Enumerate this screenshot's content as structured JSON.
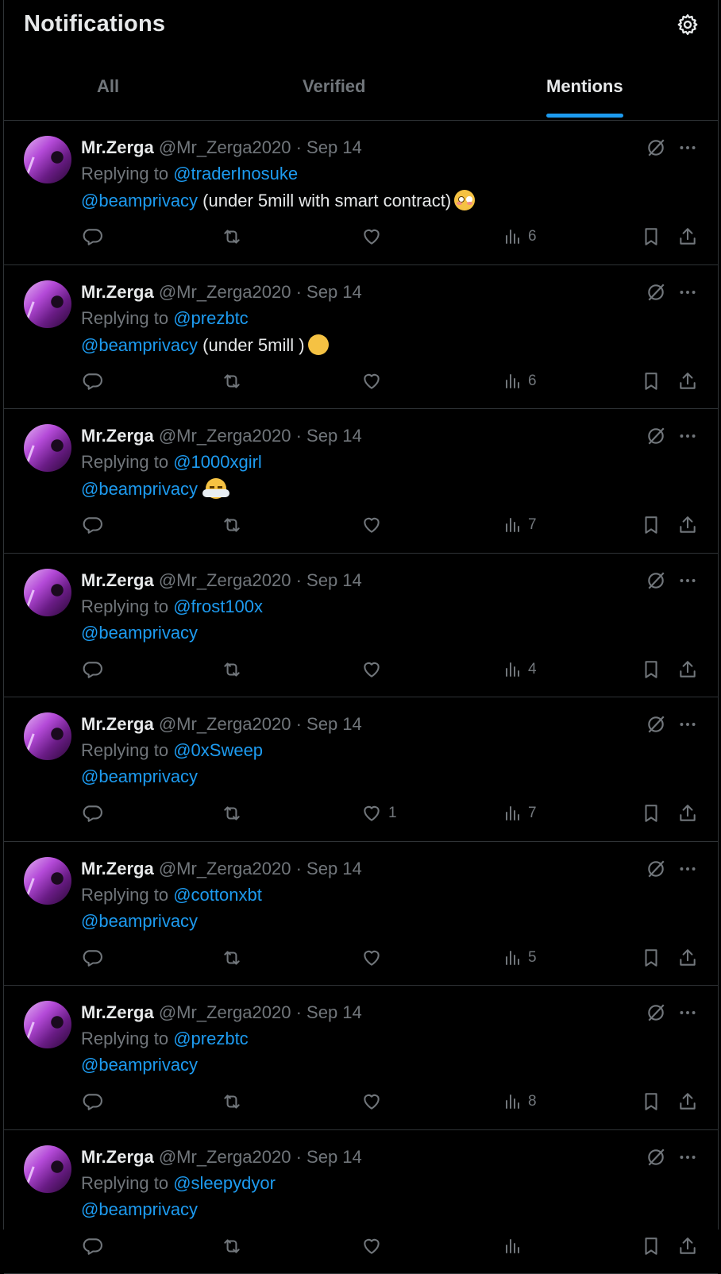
{
  "header": {
    "title": "Notifications",
    "settings_icon": "gear-icon",
    "tabs": [
      {
        "label": "All",
        "active": false
      },
      {
        "label": "Verified",
        "active": false
      },
      {
        "label": "Mentions",
        "active": true
      }
    ]
  },
  "colors": {
    "accent": "#1d9bf0",
    "text": "#e7e9ea",
    "muted": "#71767b",
    "border": "#2f3336",
    "background": "#000000"
  },
  "posts": [
    {
      "name": "Mr.Zerga",
      "handle": "@Mr_Zerga2020",
      "dot": "·",
      "date": "Sep 14",
      "replying_prefix": "Replying to",
      "replying_to": "@traderInosuke",
      "mention": "@beamprivacy",
      "text": " (under 5mill with smart contract)",
      "emoji": "flushed-face-emoji",
      "likes": "",
      "views": "6"
    },
    {
      "name": "Mr.Zerga",
      "handle": "@Mr_Zerga2020",
      "dot": "·",
      "date": "Sep 14",
      "replying_prefix": "Replying to",
      "replying_to": "@prezbtc",
      "mention": "@beamprivacy",
      "text": " (under 5mill )",
      "emoji": "kissing-face-emoji",
      "likes": "",
      "views": "6"
    },
    {
      "name": "Mr.Zerga",
      "handle": "@Mr_Zerga2020",
      "dot": "·",
      "date": "Sep 14",
      "replying_prefix": "Replying to",
      "replying_to": "@1000xgirl",
      "mention": "@beamprivacy",
      "text": " ",
      "emoji": "steam-face-emoji",
      "likes": "",
      "views": "7"
    },
    {
      "name": "Mr.Zerga",
      "handle": "@Mr_Zerga2020",
      "dot": "·",
      "date": "Sep 14",
      "replying_prefix": "Replying to",
      "replying_to": "@frost100x",
      "mention": "@beamprivacy",
      "text": "",
      "emoji": "",
      "likes": "",
      "views": "4"
    },
    {
      "name": "Mr.Zerga",
      "handle": "@Mr_Zerga2020",
      "dot": "·",
      "date": "Sep 14",
      "replying_prefix": "Replying to",
      "replying_to": "@0xSweep",
      "mention": "@beamprivacy",
      "text": "",
      "emoji": "",
      "likes": "1",
      "views": "7"
    },
    {
      "name": "Mr.Zerga",
      "handle": "@Mr_Zerga2020",
      "dot": "·",
      "date": "Sep 14",
      "replying_prefix": "Replying to",
      "replying_to": "@cottonxbt",
      "mention": "@beamprivacy",
      "text": "",
      "emoji": "",
      "likes": "",
      "views": "5"
    },
    {
      "name": "Mr.Zerga",
      "handle": "@Mr_Zerga2020",
      "dot": "·",
      "date": "Sep 14",
      "replying_prefix": "Replying to",
      "replying_to": "@prezbtc",
      "mention": "@beamprivacy",
      "text": "",
      "emoji": "",
      "likes": "",
      "views": "8"
    },
    {
      "name": "Mr.Zerga",
      "handle": "@Mr_Zerga2020",
      "dot": "·",
      "date": "Sep 14",
      "replying_prefix": "Replying to",
      "replying_to": "@sleepydyor",
      "mention": "@beamprivacy",
      "text": "",
      "emoji": "",
      "likes": "",
      "views": ""
    }
  ]
}
